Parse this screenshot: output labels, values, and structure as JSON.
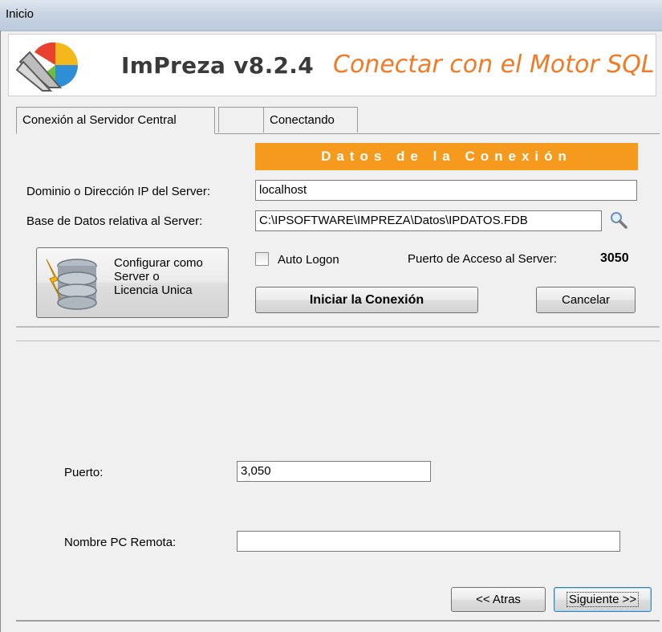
{
  "window": {
    "title": "Inicio"
  },
  "header": {
    "app_name": "ImPreza v8.2.4",
    "subtitle": "Conectar con el Motor SQL"
  },
  "tabs": [
    {
      "label": "Conexión al Servidor Central",
      "active": true
    },
    {
      "label": "",
      "active": false
    },
    {
      "label": "Conectando",
      "active": false
    }
  ],
  "connection": {
    "section_title": "Datos de la Conexión",
    "domain_label": "Dominio o Dirección IP del Server:",
    "domain_value": "localhost",
    "database_label": "Base de Datos relativa al Server:",
    "database_value": "C:\\IPSOFTWARE\\IMPREZA\\Datos\\IPDATOS.FDB",
    "config_button": [
      "Configurar como",
      "Server o",
      "Licencia Unica"
    ],
    "auto_logon_label": "Auto Logon",
    "auto_logon_checked": false,
    "port_access_label": "Puerto de Acceso al Server:",
    "port_access_value": "3050",
    "connect_button": "Iniciar la Conexión",
    "cancel_button": "Cancelar"
  },
  "remote": {
    "port_label": "Puerto:",
    "port_value": "3,050",
    "pc_label": "Nombre PC Remota:",
    "pc_value": ""
  },
  "nav": {
    "back_button": "<< Atras",
    "next_button": "Siguiente >>"
  },
  "colors": {
    "accent_orange": "#f59a1c",
    "subtitle_orange": "#f07a25"
  }
}
